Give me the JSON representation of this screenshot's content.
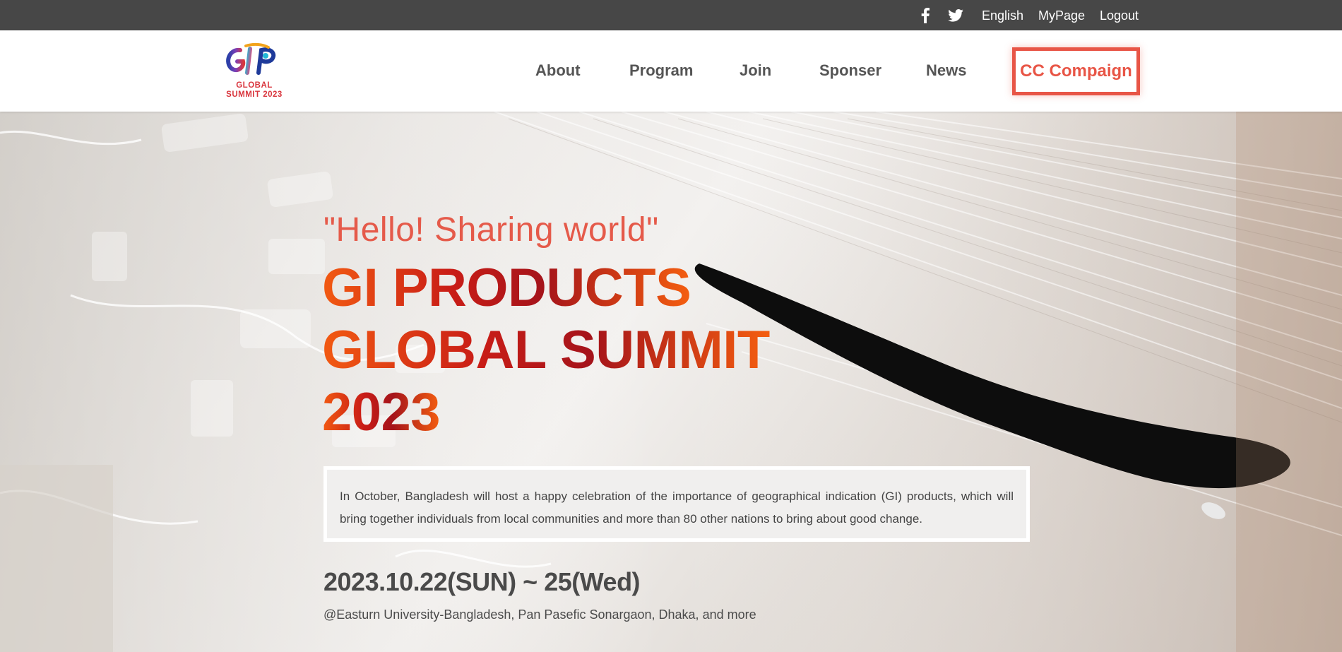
{
  "topbar": {
    "social": [
      {
        "icon": "facebook-icon"
      },
      {
        "icon": "twitter-icon"
      }
    ],
    "language": "English",
    "mypage": "MyPage",
    "logout": "Logout"
  },
  "header": {
    "logo": {
      "mark": "GIP",
      "line1": "GLOBAL",
      "line2": "SUMMIT 2023"
    },
    "nav": {
      "about": "About",
      "program": "Program",
      "join": "Join",
      "sponser": "Sponser",
      "news": "News"
    },
    "cta": "CC Compaign"
  },
  "hero": {
    "tagline": "\"Hello! Sharing world\"",
    "title_line1": "GI PRODUCTS",
    "title_line2": "GLOBAL SUMMIT",
    "title_line3": "2023",
    "description": "In October, Bangladesh will host a happy celebration of the importance of geographical indication (GI) products, which will bring together individuals from local communities and more than 80 other nations to bring about good change.",
    "date": "2023.10.22(SUN) ~ 25(Wed)",
    "venue": "@Easturn University-Bangladesh, Pan Pasefic Sonargaon, Dhaka, and more"
  },
  "colors": {
    "topbar_bg": "#474747",
    "accent": "#e85546",
    "title_red": "#c91d17",
    "title_orange": "#f25a12"
  }
}
